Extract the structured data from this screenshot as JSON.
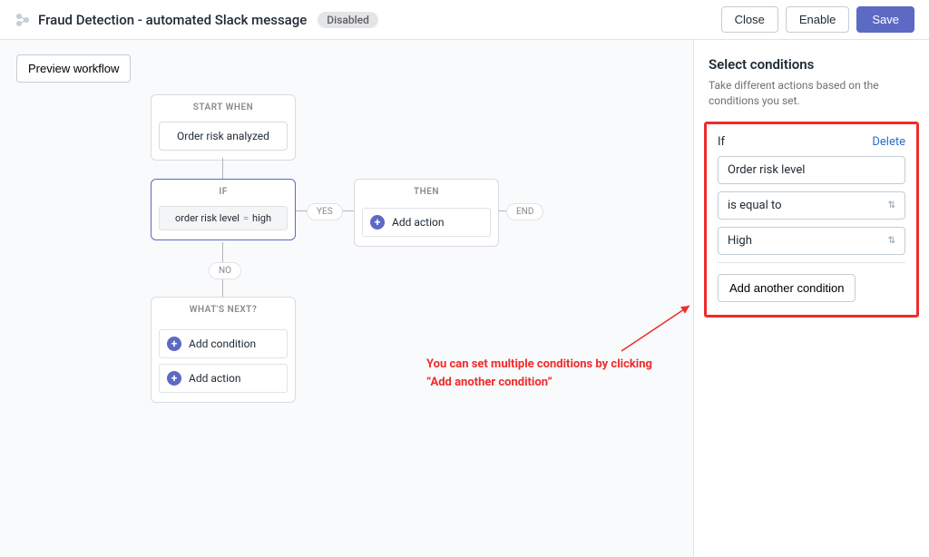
{
  "header": {
    "title": "Fraud Detection - automated Slack message",
    "status": "Disabled",
    "close": "Close",
    "enable": "Enable",
    "save": "Save"
  },
  "canvas": {
    "preview": "Preview workflow",
    "start_head": "START WHEN",
    "start_body": "Order risk analyzed",
    "if_head": "IF",
    "if_cond_left": "order risk level",
    "if_cond_eq": "=",
    "if_cond_right": "high",
    "yes": "YES",
    "no": "NO",
    "end": "END",
    "then_head": "THEN",
    "add_action": "Add action",
    "next_head": "WHAT'S NEXT?",
    "add_condition": "Add condition"
  },
  "sidebar": {
    "title": "Select conditions",
    "desc": "Take different actions based on the conditions you set.",
    "if_label": "If",
    "delete": "Delete",
    "field1": "Order risk level",
    "field2": "is equal to",
    "field3": "High",
    "add_another": "Add another condition"
  },
  "annotation": {
    "line1": "You can set multiple conditions by clicking",
    "line2": "“Add another condition”"
  }
}
